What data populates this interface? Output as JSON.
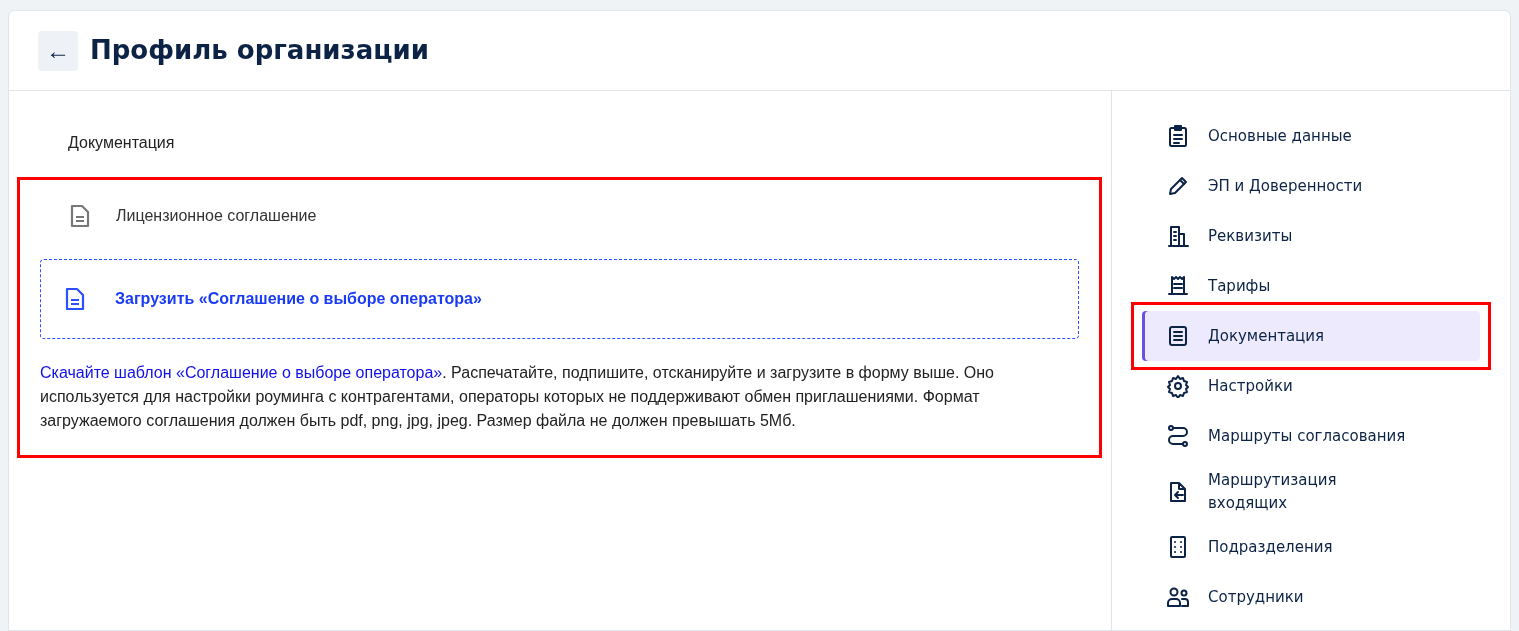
{
  "header": {
    "back_label": "←",
    "title": "Профиль организации"
  },
  "section": {
    "title": "Документация",
    "highlighted": true,
    "documents": [
      {
        "label": "Лицензионное соглашение"
      }
    ],
    "upload": {
      "label": "Загрузить «Соглашение о выборе оператора»"
    },
    "help": {
      "link": "Скачайте шаблон «Соглашение о выборе оператора»",
      "text": ". Распечатайте, подпишите, отсканируйте и загрузите в форму выше. Оно используется для настройки роуминга с контрагентами, операторы которых не поддерживают обмен приглашениями. Формат загружаемого соглашения должен быть pdf, png, jpg, jpeg. Размер файла не должен превышать 5Мб."
    }
  },
  "sidebar": {
    "items": [
      {
        "label": "Основные данные",
        "selected": false,
        "highlighted": false
      },
      {
        "label": "ЭП и Доверенности",
        "selected": false,
        "highlighted": false
      },
      {
        "label": "Реквизиты",
        "selected": false,
        "highlighted": false
      },
      {
        "label": "Тарифы",
        "selected": false,
        "highlighted": false
      },
      {
        "label": "Документация",
        "selected": true,
        "highlighted": true
      },
      {
        "label": "Настройки",
        "selected": false,
        "highlighted": false
      },
      {
        "label": "Маршруты согласования",
        "selected": false,
        "highlighted": false
      },
      {
        "label": "Маршрутизация входящих",
        "selected": false,
        "highlighted": false
      },
      {
        "label": "Подразделения",
        "selected": false,
        "highlighted": false
      },
      {
        "label": "Сотрудники",
        "selected": false,
        "highlighted": false
      }
    ]
  }
}
